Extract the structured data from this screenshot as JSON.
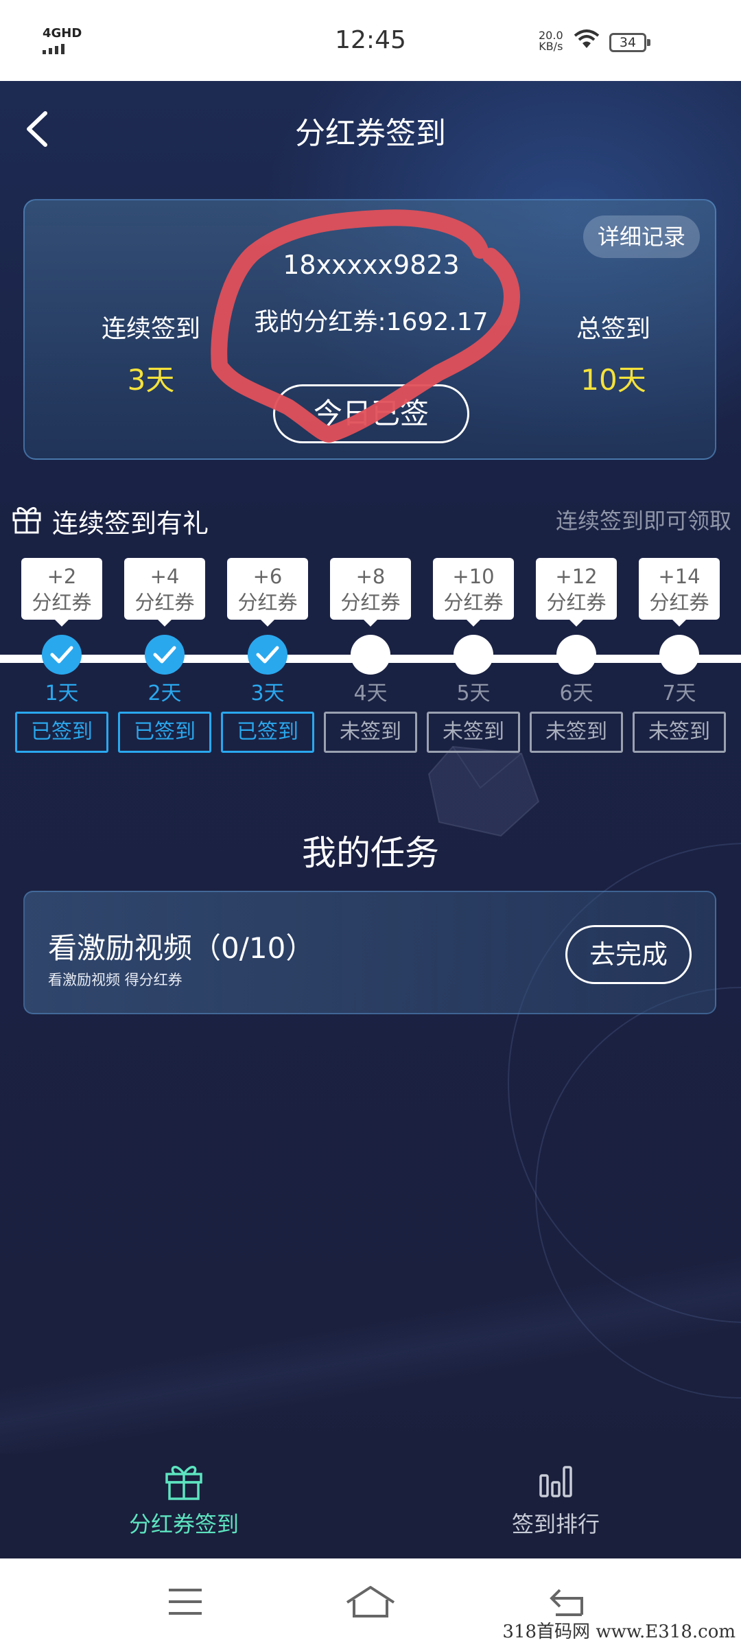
{
  "status_bar": {
    "network": "4GHD",
    "time": "12:45",
    "speed_value": "20.0",
    "speed_unit": "KB/s",
    "battery": "34"
  },
  "header": {
    "title": "分红券签到",
    "back_icon": "chevron-left-icon"
  },
  "card": {
    "detail_button": "详细记录",
    "phone": "18xxxxx9823",
    "balance": "我的分红券:1692.17",
    "streak_label": "连续签到",
    "streak_value": "3天",
    "total_label": "总签到",
    "total_value": "10天",
    "signed_button": "今日已签",
    "annotation_color": "#e0505a"
  },
  "gifts": {
    "title": "连续签到有礼",
    "hint": "连续签到即可领取",
    "days": [
      {
        "reward": "+2",
        "reward_unit": "分红券",
        "day": "1天",
        "status": "已签到",
        "done": true
      },
      {
        "reward": "+4",
        "reward_unit": "分红券",
        "day": "2天",
        "status": "已签到",
        "done": true
      },
      {
        "reward": "+6",
        "reward_unit": "分红券",
        "day": "3天",
        "status": "已签到",
        "done": true
      },
      {
        "reward": "+8",
        "reward_unit": "分红券",
        "day": "4天",
        "status": "未签到",
        "done": false
      },
      {
        "reward": "+10",
        "reward_unit": "分红券",
        "day": "5天",
        "status": "未签到",
        "done": false
      },
      {
        "reward": "+12",
        "reward_unit": "分红券",
        "day": "6天",
        "status": "未签到",
        "done": false
      },
      {
        "reward": "+14",
        "reward_unit": "分红券",
        "day": "7天",
        "status": "未签到",
        "done": false
      }
    ]
  },
  "tasks": {
    "title": "我的任务",
    "items": [
      {
        "name": "看激励视频（0/10）",
        "desc": "看激励视频 得分红券",
        "button": "去完成"
      }
    ]
  },
  "tabbar": {
    "tabs": [
      {
        "label": "分红券签到",
        "icon": "gift-icon",
        "active": true
      },
      {
        "label": "签到排行",
        "icon": "bar-chart-icon",
        "active": false
      }
    ]
  },
  "nav": {
    "menu_icon": "menu-icon",
    "home_icon": "home-icon",
    "back_icon": "back-arrow-icon"
  },
  "watermark": "318首码网  www.E318.com",
  "colors": {
    "accent_blue": "#2aa8ee",
    "accent_yellow": "#f5e23a",
    "accent_green": "#5de4c0",
    "background": "#1b2244"
  }
}
